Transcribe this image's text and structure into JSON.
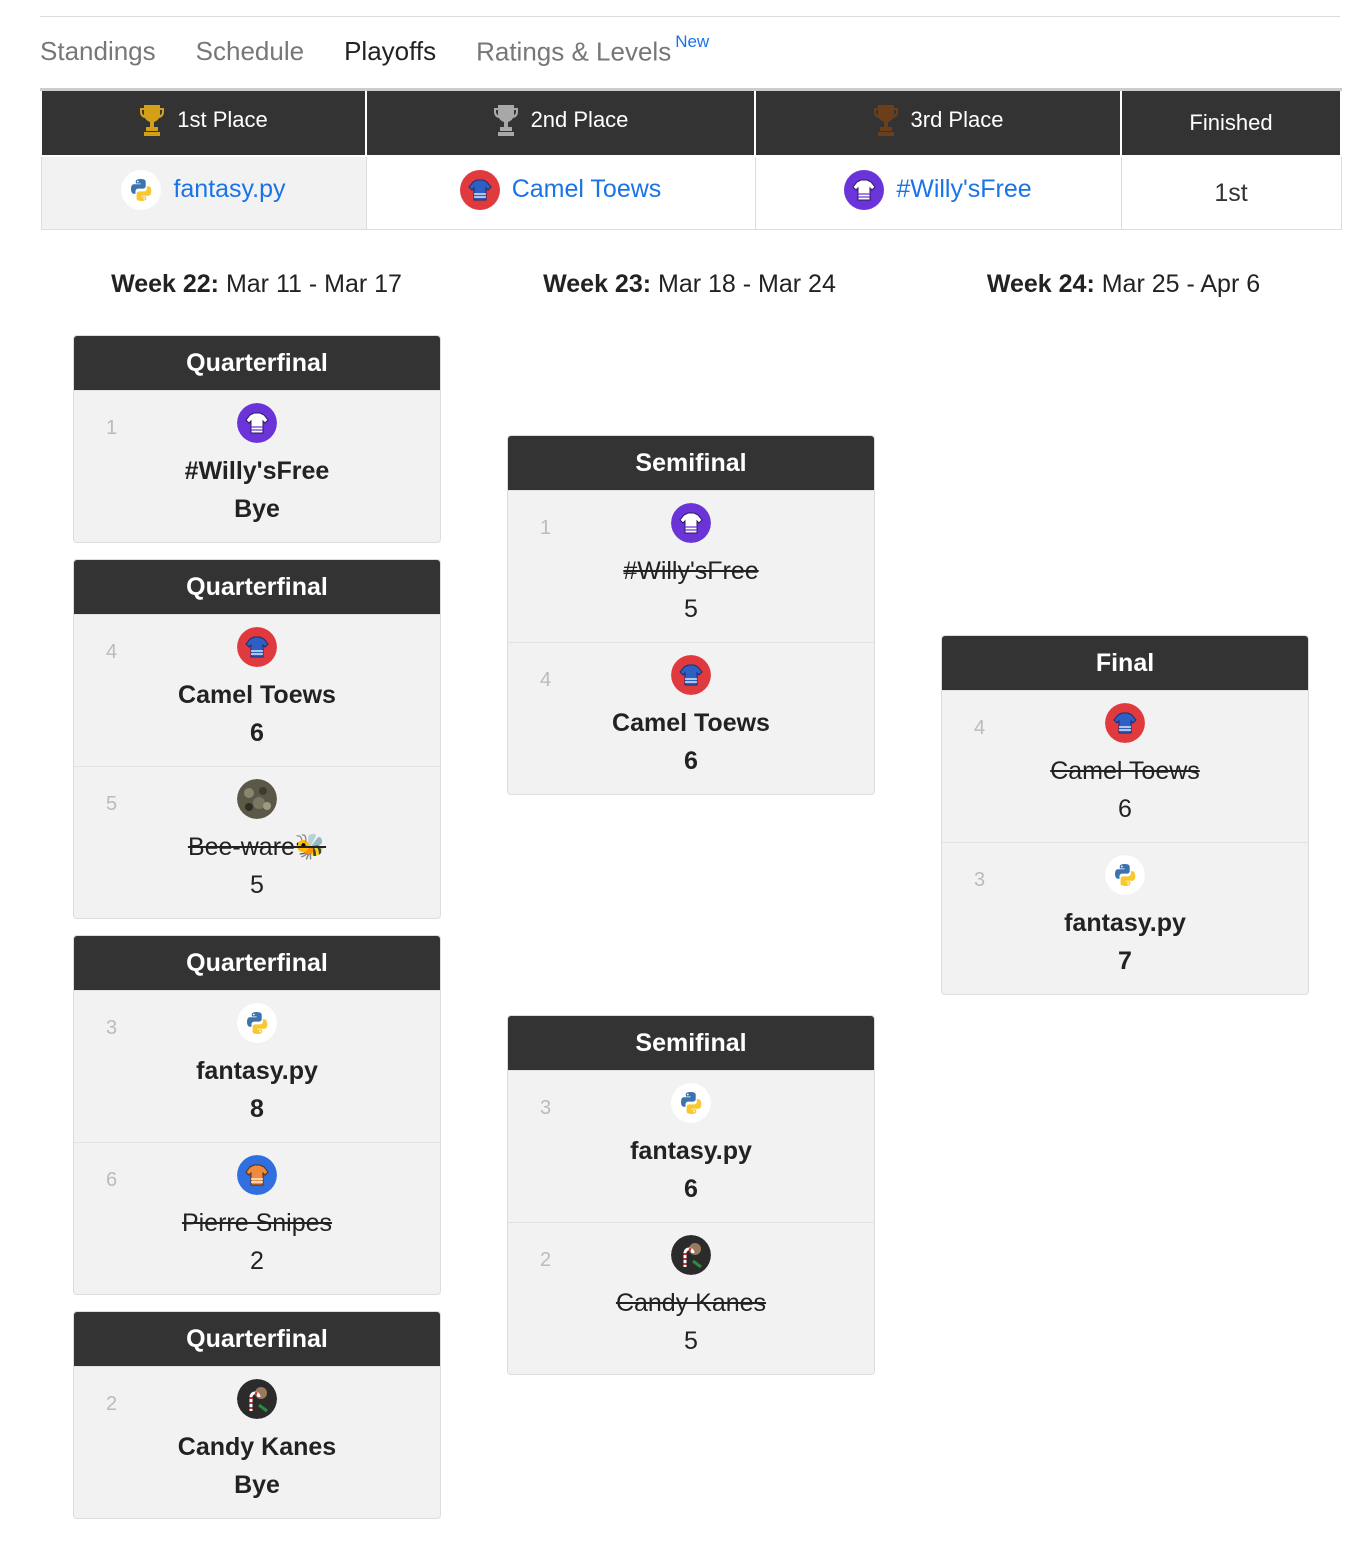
{
  "tabs": [
    {
      "label": "Standings"
    },
    {
      "label": "Schedule"
    },
    {
      "label": "Playoffs"
    },
    {
      "label": "Ratings & Levels",
      "badge": "New"
    }
  ],
  "standings": {
    "headers": [
      "1st Place",
      "2nd Place",
      "3rd Place",
      "Finished"
    ],
    "first": "fantasy.py",
    "second": "Camel Toews",
    "third": "#Willy'sFree",
    "finished": "1st"
  },
  "weeks": [
    {
      "label": "Week 22:",
      "range": "Mar 11 - Mar 17"
    },
    {
      "label": "Week 23:",
      "range": "Mar 18 - Mar 24"
    },
    {
      "label": "Week 24:",
      "range": "Mar 25 - Apr 6"
    }
  ],
  "matches": {
    "qf1": {
      "title": "Quarterfinal",
      "a": {
        "seed": "1",
        "name": "#Willy'sFree",
        "score": "Bye",
        "avatar": "purple-jersey-icon"
      }
    },
    "qf2": {
      "title": "Quarterfinal",
      "a": {
        "seed": "4",
        "name": "Camel Toews",
        "score": "6",
        "avatar": "red-jersey-icon"
      },
      "b": {
        "seed": "5",
        "name": "Bee-ware🐝",
        "score": "5",
        "avatar": "photo-avatar"
      }
    },
    "qf3": {
      "title": "Quarterfinal",
      "a": {
        "seed": "3",
        "name": "fantasy.py",
        "score": "8",
        "avatar": "python-icon"
      },
      "b": {
        "seed": "6",
        "name": "Pierre Snipes",
        "score": "2",
        "avatar": "orange-jersey-icon"
      }
    },
    "qf4": {
      "title": "Quarterfinal",
      "a": {
        "seed": "2",
        "name": "Candy Kanes",
        "score": "Bye",
        "avatar": "candy-cane-avatar"
      }
    },
    "sf1": {
      "title": "Semifinal",
      "a": {
        "seed": "1",
        "name": "#Willy'sFree",
        "score": "5",
        "avatar": "purple-jersey-icon"
      },
      "b": {
        "seed": "4",
        "name": "Camel Toews",
        "score": "6",
        "avatar": "red-jersey-icon"
      }
    },
    "sf2": {
      "title": "Semifinal",
      "a": {
        "seed": "3",
        "name": "fantasy.py",
        "score": "6",
        "avatar": "python-icon"
      },
      "b": {
        "seed": "2",
        "name": "Candy Kanes",
        "score": "5",
        "avatar": "candy-cane-avatar"
      }
    },
    "final": {
      "title": "Final",
      "a": {
        "seed": "4",
        "name": "Camel Toews",
        "score": "6",
        "avatar": "red-jersey-icon"
      },
      "b": {
        "seed": "3",
        "name": "fantasy.py",
        "score": "7",
        "avatar": "python-icon"
      }
    }
  },
  "colors": {
    "header_bg": "#333333",
    "link": "#1a73e8",
    "card_bg": "#f2f2f2",
    "gold": "#d4a017",
    "silver": "#a8a8a8",
    "bronze": "#8b5a2b"
  }
}
